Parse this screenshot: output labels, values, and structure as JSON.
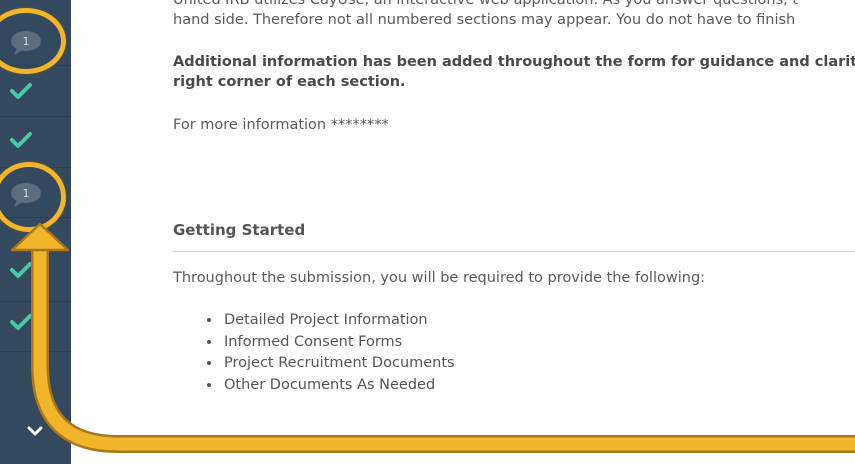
{
  "sidebar": {
    "rows": [
      {
        "type": "comment",
        "count": "1"
      },
      {
        "type": "check"
      },
      {
        "type": "check"
      },
      {
        "type": "comment",
        "count": "1"
      },
      {
        "type": "check"
      },
      {
        "type": "check"
      }
    ],
    "chevron_icon": "chevron-down-icon"
  },
  "intro": {
    "line1": "United IRB utilizes CayUse, an interactive web application. As you answer questions, t",
    "line2": "hand side. Therefore not all numbered sections may appear. You do not have to finish",
    "note_line1": "Additional information has been added throughout the form for guidance and clarit",
    "note_line2": "right corner of each section.",
    "more_info": "For more information ********"
  },
  "getting_started": {
    "heading": "Getting Started",
    "description": "Throughout the submission, you will be required to provide the following:",
    "items": [
      "Detailed Project Information",
      "Informed Consent Forms",
      "Project Recruitment Documents",
      "Other Documents As Needed"
    ]
  },
  "colors": {
    "sidebar_bg": "#34495e",
    "check_green": "#48c9a5",
    "highlight_orange": "#f0b52a",
    "bubble_gray": "#7f8c8d"
  }
}
